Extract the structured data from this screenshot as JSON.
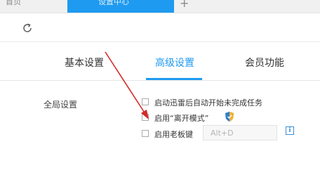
{
  "browser": {
    "home_tab": "首页",
    "active_tab": "设置中心",
    "new_tab": "+"
  },
  "settings": {
    "tabs": [
      {
        "label": "基本设置",
        "active": false
      },
      {
        "label": "高级设置",
        "active": true
      },
      {
        "label": "会员功能",
        "active": false
      }
    ],
    "accent": "#1e9af0",
    "section_label": "全局设置",
    "options": [
      {
        "label": "启动迅雷后自动开始未完成任务",
        "checked": false
      },
      {
        "label": "启用“离开模式”",
        "checked": false
      },
      {
        "label": "启用老板键",
        "checked": false
      }
    ],
    "hotkey_value": "Alt+D",
    "info_glyph": "i"
  },
  "annotation_color": "#d42a2a"
}
